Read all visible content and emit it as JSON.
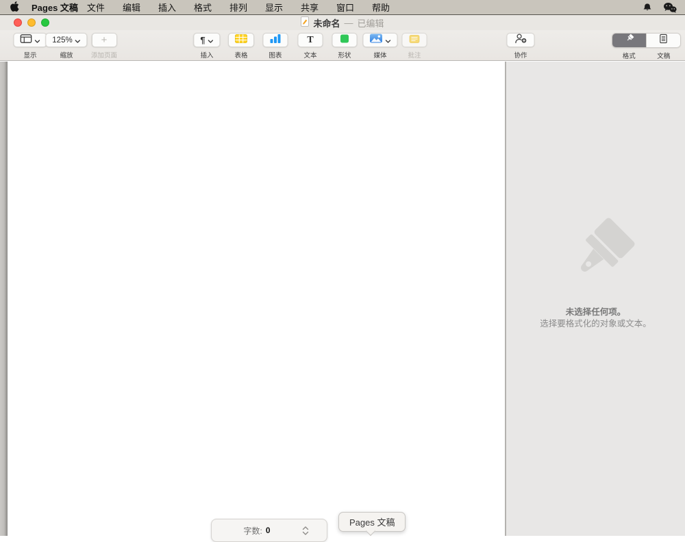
{
  "menubar": {
    "app_name": "Pages 文稿",
    "items": [
      "文件",
      "编辑",
      "插入",
      "格式",
      "排列",
      "显示",
      "共享",
      "窗口",
      "帮助"
    ]
  },
  "titlebar": {
    "title": "未命名",
    "separator": "—",
    "status": "已编辑"
  },
  "toolbar": {
    "view": {
      "label": "显示"
    },
    "zoom": {
      "value": "125%",
      "label": "缩放"
    },
    "add_page": {
      "glyph": "+",
      "label": "添加页面"
    },
    "insert": {
      "glyph": "¶",
      "label": "插入"
    },
    "table": {
      "label": "表格"
    },
    "chart": {
      "label": "图表"
    },
    "text": {
      "glyph": "T",
      "label": "文本"
    },
    "shape": {
      "label": "形状"
    },
    "media": {
      "label": "媒体"
    },
    "comment": {
      "label": "批注"
    },
    "collaborate": {
      "label": "协作"
    },
    "format": {
      "label": "格式"
    },
    "document": {
      "label": "文稿"
    }
  },
  "sidebar": {
    "empty_title": "未选择任何项。",
    "empty_subtitle": "选择要格式化的对象或文本。"
  },
  "statusbar": {
    "word_count_label": "字数:",
    "word_count_value": "0"
  },
  "tooltip": {
    "label": "Pages 文稿"
  },
  "colors": {
    "menubar_bg": "#c9c5bc",
    "titlebar_bg": "#e9e7e3",
    "toolbar_bg": "#ebe8e5",
    "sidebar_bg": "#e8e7e6",
    "traffic_red": "#ff5f57",
    "traffic_yellow": "#febc2e",
    "traffic_green": "#28c840",
    "table_icon_yellow": "#ffd326",
    "chart_icon_blue": "#1f98f5",
    "shape_icon_green": "#30c758",
    "media_icon_blue": "#3e8fe6",
    "comment_icon_yellow": "#fbd54e",
    "segment_selected": "#78777c"
  }
}
